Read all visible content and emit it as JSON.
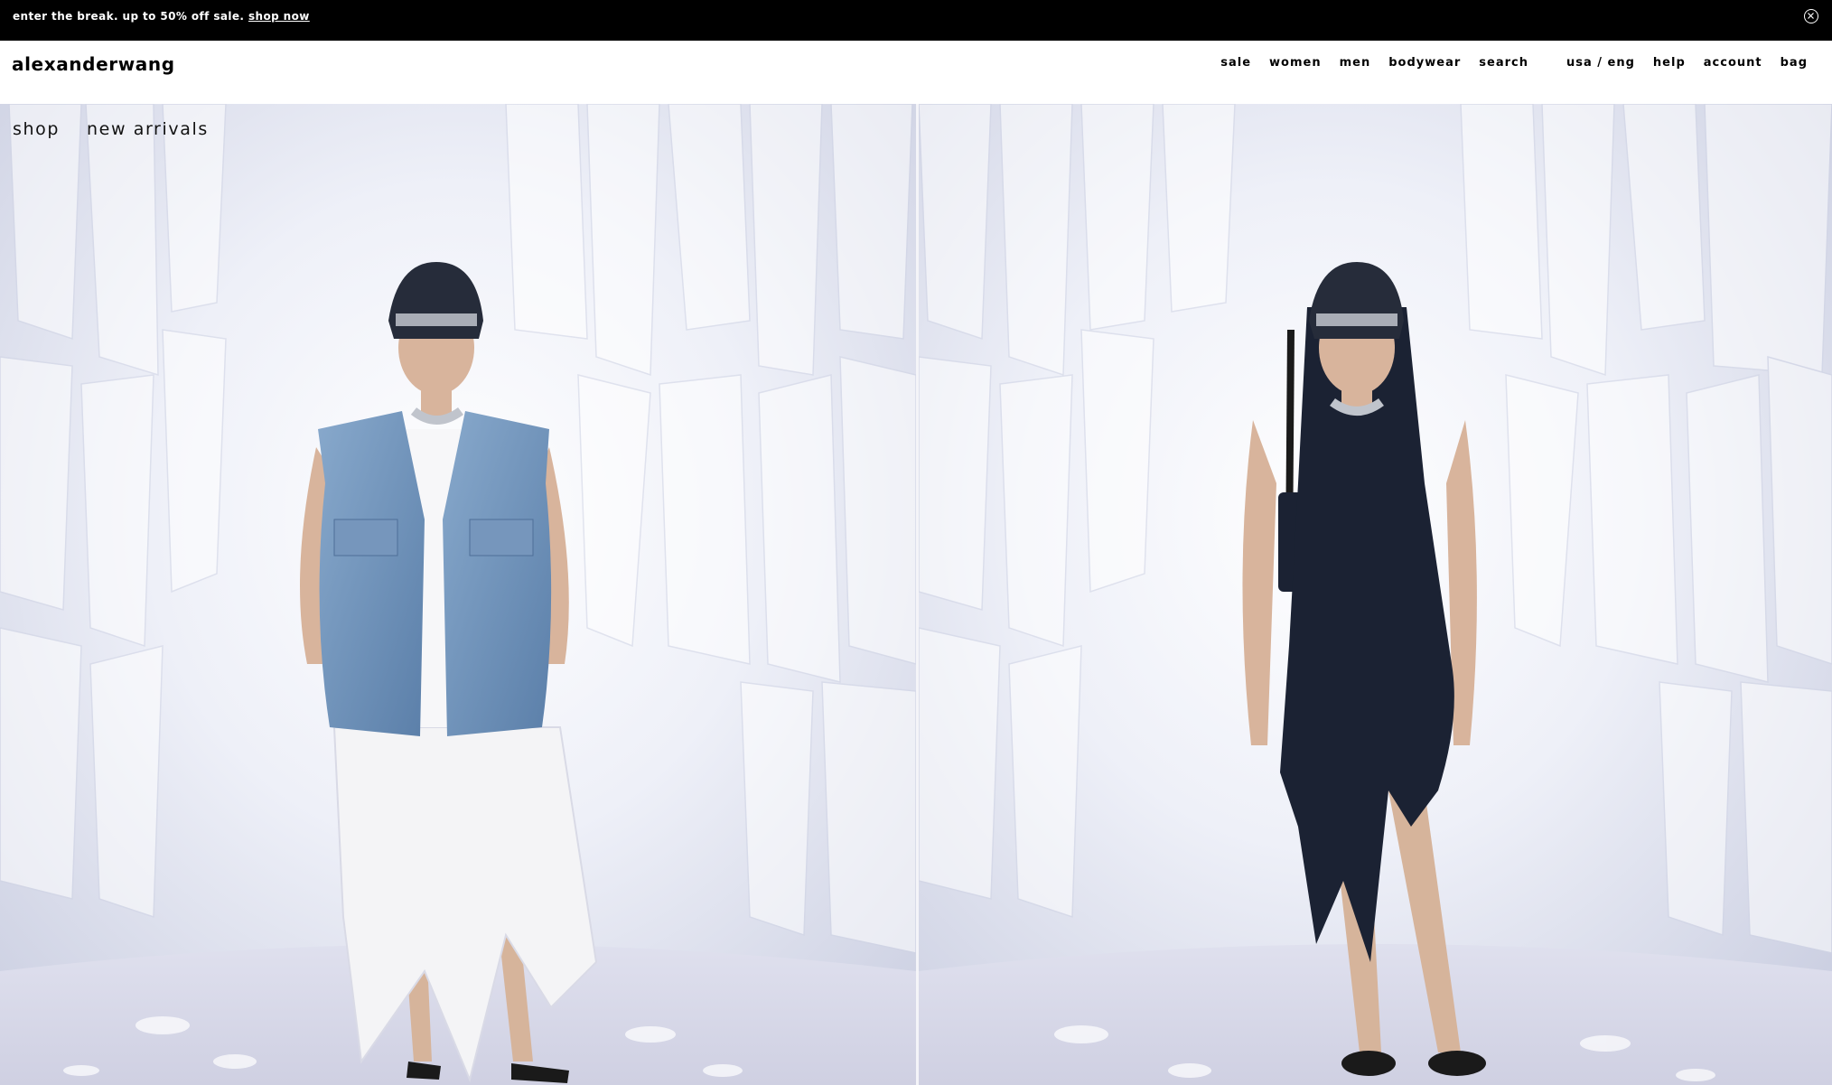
{
  "promo": {
    "text": "enter the break. up to 50% off sale.",
    "link_label": "shop now"
  },
  "header": {
    "logo": "alexanderwang",
    "nav_primary": [
      "sale",
      "women",
      "men",
      "bodywear",
      "search"
    ],
    "nav_secondary": [
      "usa / eng",
      "help",
      "account",
      "bag"
    ]
  },
  "breadcrumb": [
    "shop",
    "new arrivals"
  ],
  "hero": {
    "left_look": "denim-vest-white-dress",
    "right_look": "black-tank-dress"
  },
  "colors": {
    "promo_bg": "#000000",
    "backdrop": "#e9ecf6",
    "denim": "#6b8fb8",
    "black_dress": "#1b2233"
  }
}
